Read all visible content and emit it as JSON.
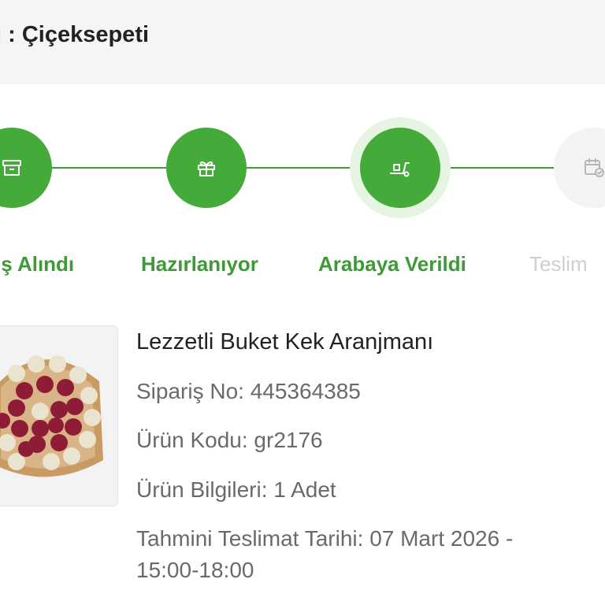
{
  "header": {
    "text": "ı : Çiçeksepeti"
  },
  "steps": [
    {
      "label": "iş Alındı",
      "icon": "box-icon",
      "state": "done"
    },
    {
      "label": "Hazırlanıyor",
      "icon": "gift-icon",
      "state": "done"
    },
    {
      "label": "Arabaya Verildi",
      "icon": "delivery-cart-icon",
      "state": "current"
    },
    {
      "label": "Teslim",
      "icon": "calendar-check-icon",
      "state": "pending"
    }
  ],
  "product": {
    "name": "Lezzetli Buket Kek Aranjmanı",
    "order_no": "Sipariş No: 445364385",
    "product_code": "Ürün Kodu: gr2176",
    "product_info": "Ürün Bilgileri: 1 Adet",
    "delivery_line1": "Tahmini Teslimat Tarihi: 07 Mart 2026 -",
    "delivery_line2": "15:00-18:00"
  },
  "colors": {
    "accent_green": "#44ab3a",
    "label_green": "#3d9b35",
    "inactive_grey": "#cfcfcf",
    "header_bg": "#f5f5f5"
  }
}
